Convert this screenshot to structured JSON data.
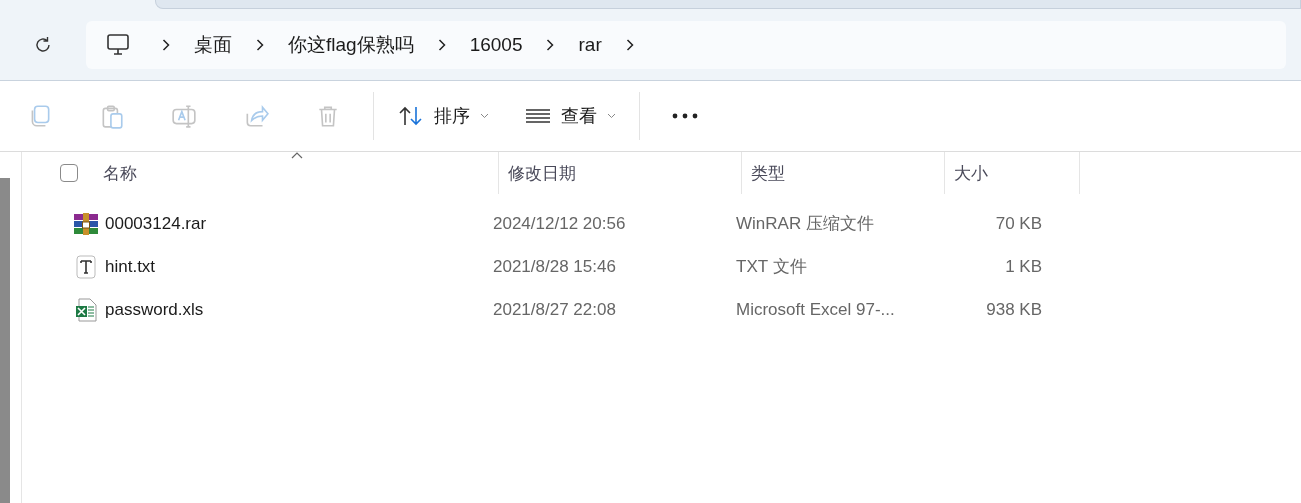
{
  "address_bar": {
    "segments": [
      "桌面",
      "你这flag保熟吗",
      "16005",
      "rar"
    ]
  },
  "toolbar": {
    "actions": [
      {
        "kind": "copy",
        "disabled": true
      },
      {
        "kind": "paste",
        "disabled": true
      },
      {
        "kind": "rename",
        "disabled": true
      },
      {
        "kind": "share",
        "disabled": true
      },
      {
        "kind": "delete",
        "disabled": true
      }
    ],
    "sort": {
      "label": "排序"
    },
    "view": {
      "label": "查看"
    }
  },
  "select_all": {
    "checked": false
  },
  "columns": [
    {
      "label": "名称",
      "sorted": true
    },
    {
      "label": "修改日期",
      "sorted": false
    },
    {
      "label": "类型",
      "sorted": false
    },
    {
      "label": "大小",
      "sorted": false
    }
  ],
  "files": [
    {
      "kind": "rar",
      "name": "00003124.rar",
      "modified": "2024/12/12 20:56",
      "type": "WinRAR 压缩文件",
      "size": "70 KB"
    },
    {
      "kind": "txt",
      "name": "hint.txt",
      "modified": "2021/8/28 15:46",
      "type": "TXT 文件",
      "size": "1 KB"
    },
    {
      "kind": "xls",
      "name": "password.xls",
      "modified": "2021/8/27 22:08",
      "type": "Microsoft Excel 97-...",
      "size": "938 KB"
    }
  ]
}
